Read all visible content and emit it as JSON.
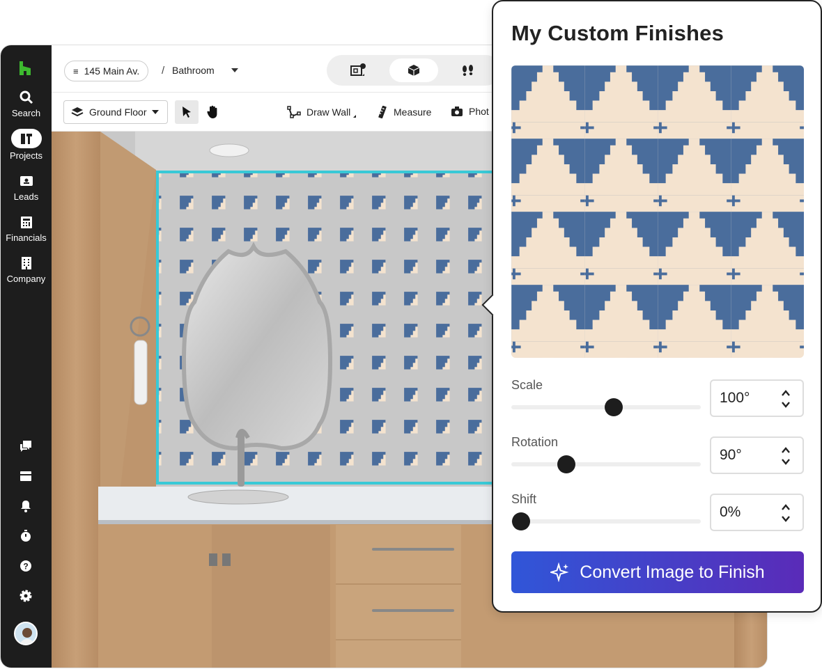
{
  "sidebar": {
    "items": [
      {
        "label": "Search",
        "icon": "search-icon"
      },
      {
        "label": "Projects",
        "icon": "projects-icon"
      },
      {
        "label": "Leads",
        "icon": "leads-icon"
      },
      {
        "label": "Financials",
        "icon": "financials-icon"
      },
      {
        "label": "Company",
        "icon": "company-icon"
      }
    ],
    "bottom_icons": [
      "chat-icon",
      "inbox-icon",
      "bell-icon",
      "timer-icon",
      "help-icon",
      "gear-icon"
    ],
    "brand_color": "#3dba2f"
  },
  "header": {
    "address": "145 Main Av.",
    "separator": "/",
    "room": "Bathroom"
  },
  "view_tabs": [
    "floorplan-icon",
    "3d-box-icon",
    "walk-footsteps-icon"
  ],
  "toolbar": {
    "floor": "Ground Floor",
    "draw_wall": "Draw Wall",
    "measure": "Measure",
    "photo": "Phot"
  },
  "panel": {
    "title": "My Custom Finishes",
    "scale": {
      "label": "Scale",
      "value": "100°",
      "fraction": 0.54
    },
    "rotation": {
      "label": "Rotation",
      "value": "90°",
      "fraction": 0.29
    },
    "shift": {
      "label": "Shift",
      "value": "0%",
      "fraction": 0.05
    },
    "convert_button": "Convert Image to Finish",
    "tile_colors": {
      "blue": "#4a6d9c",
      "cream": "#f4e3cf"
    }
  }
}
